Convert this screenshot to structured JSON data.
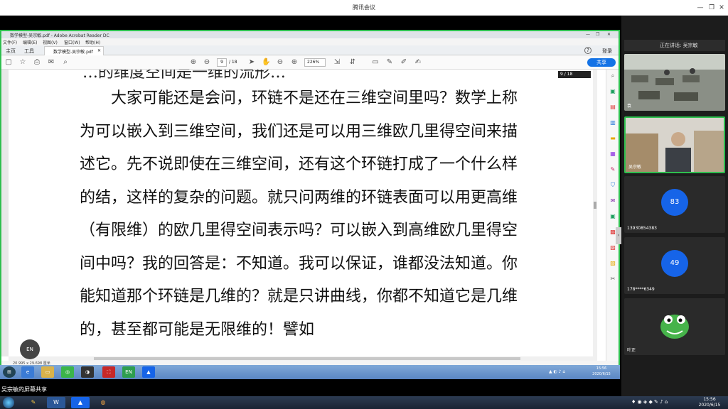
{
  "meeting": {
    "title": "腾讯会议",
    "share_label": "吴宗敏的屏幕共享"
  },
  "acrobat": {
    "window_title": "数学模型-吴宗敏.pdf - Adobe Acrobat Reader DC",
    "menu": [
      "文件(F)",
      "编辑(E)",
      "视图(V)",
      "窗口(W)",
      "帮助(H)"
    ],
    "tabs": {
      "home": "主页",
      "tools": "工具",
      "document": "数学模型-吴宗敏.pdf"
    },
    "login": "登录",
    "share": "共享",
    "page_current": "9",
    "page_total": "/ 18",
    "zoom": "226%",
    "page_overlay": "9 / 18",
    "page_size": "20.995 x 29.698 厘米"
  },
  "document": {
    "partial_line": "…的维度空间是一维的流形…",
    "lines": [
      "　　大家可能还是会问，环链不是还在三维空间里吗？数学上称",
      "为可以嵌入到三维空间，我们还是可以用三维欧几里得空间来描",
      "述它。先不说即使在三维空间，还有这个环链打成了一个什么样",
      "的结，这样的复杂的问题。就只问两维的环链表面可以用更高维",
      "（有限维）的欧几里得空间表示吗？可以嵌入到高维欧几里得空",
      "间中吗？我的回答是：不知道。我可以保证，谁都没法知道。你",
      "能知道那个环链是几维的？就是只讲曲线，你都不知道它是几维",
      "的，甚至都可能是无限维的！譬如"
    ]
  },
  "float_button": "EN",
  "remote_taskbar": {
    "clock_time": "15:56",
    "clock_date": "2020/6/15",
    "tray": "▲ ◐ ♪ ⌂"
  },
  "participants": {
    "speaking": "正在讲话: 吴宗敏",
    "tiles": [
      {
        "name": "袁",
        "type": "video"
      },
      {
        "name": "吴宗敏",
        "type": "video"
      },
      {
        "name": "13930854383",
        "avatar": "83"
      },
      {
        "name": "178****6349",
        "avatar": "49"
      },
      {
        "name": "叶正",
        "type": "mascot"
      }
    ]
  },
  "local_taskbar": {
    "clock_time": "15:56",
    "clock_date": "2020/6/15",
    "tray": "♦ ◉ ◈ ◆ ✎ ♪ ⌂"
  },
  "colors": {
    "accent_green": "#2fbf4f",
    "avatar_blue": "#1664e8",
    "share_blue": "#1473e6"
  }
}
